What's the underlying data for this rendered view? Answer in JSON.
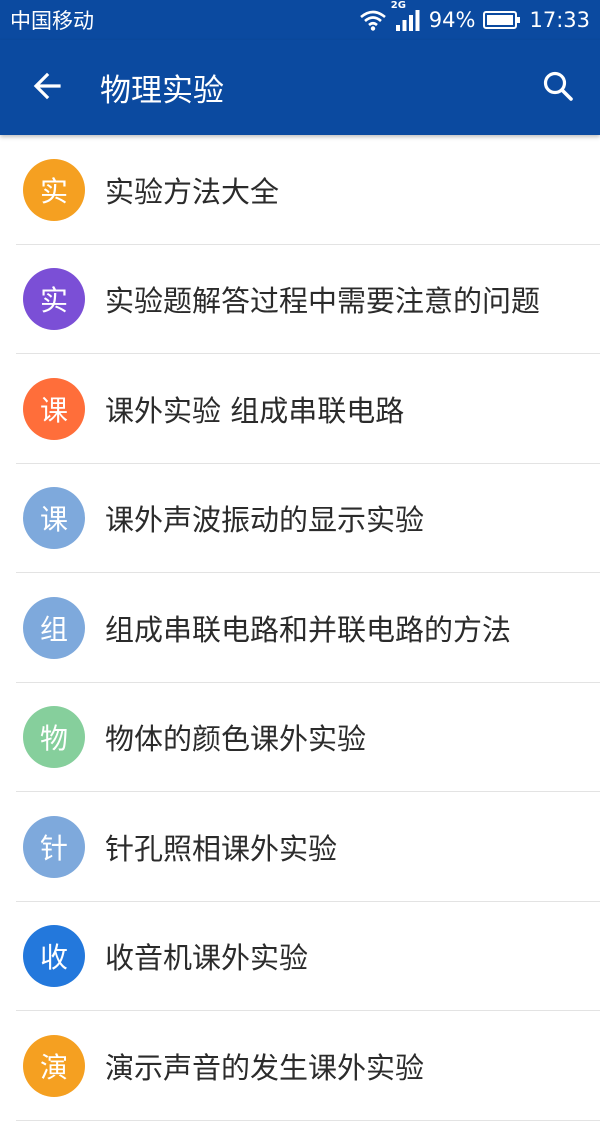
{
  "status_bar": {
    "carrier": "中国移动",
    "network": "2G",
    "battery": "94%",
    "time": "17:33",
    "icons": [
      "wifi-icon",
      "signal-icon",
      "battery-icon"
    ]
  },
  "app_bar": {
    "title": "物理实验",
    "back_icon": "arrow-left-icon",
    "search_icon": "search-icon"
  },
  "colors": {
    "primary": "#0b4aa0",
    "orange": "#f5a021",
    "purple": "#7b4fd6",
    "red_orange": "#ff6e3a",
    "light_blue": "#7ea9dc",
    "green": "#86cf9c",
    "blue": "#2378dc"
  },
  "items": [
    {
      "letter": "实",
      "label": "实验方法大全",
      "color": "#f5a021"
    },
    {
      "letter": "实",
      "label": "实验题解答过程中需要注意的问题",
      "color": "#7b4fd6"
    },
    {
      "letter": "课",
      "label": "课外实验 组成串联电路",
      "color": "#ff6e3a"
    },
    {
      "letter": "课",
      "label": "课外声波振动的显示实验",
      "color": "#7ea9dc"
    },
    {
      "letter": "组",
      "label": "组成串联电路和并联电路的方法",
      "color": "#7ea9dc"
    },
    {
      "letter": "物",
      "label": "物体的颜色课外实验",
      "color": "#86cf9c"
    },
    {
      "letter": "针",
      "label": "针孔照相课外实验",
      "color": "#7ea9dc"
    },
    {
      "letter": "收",
      "label": "收音机课外实验",
      "color": "#2378dc"
    },
    {
      "letter": "演",
      "label": "演示声音的发生课外实验",
      "color": "#f5a021"
    }
  ]
}
